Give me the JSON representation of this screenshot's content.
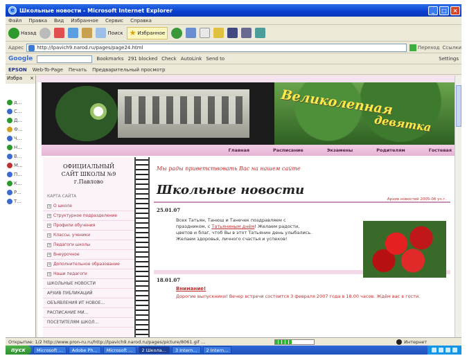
{
  "window": {
    "title": "Школьные новости - Microsoft Internet Explorer"
  },
  "menu": [
    "Файл",
    "Правка",
    "Вид",
    "Избранное",
    "Сервис",
    "Справка"
  ],
  "toolbar": {
    "back_label": "Назад",
    "search_label": "Поиск",
    "favorites_label": "Избранное"
  },
  "address": {
    "label": "Адрес",
    "url": "http://lpavich9.narod.ru/pages/page24.html",
    "go_label": "Переход",
    "links_label": "Ссылки"
  },
  "google": {
    "logo": "Google",
    "bookmarks_label": "Bookmarks",
    "blocked_label": "291 blocked",
    "check_label": "Check",
    "autolink_label": "AutoLink",
    "sendto_label": "Send to",
    "settings_label": "Settings"
  },
  "epson": {
    "logo": "EPSON",
    "web_to_page_label": "Web-To-Page",
    "print_label": "Печать",
    "preview_label": "Предварительный просмотр"
  },
  "leftpanel": {
    "label": "Избра"
  },
  "banner": {
    "title_line1": "Великолепная",
    "title_line2": "девятка"
  },
  "nav": [
    "Главная",
    "Расписание",
    "Экзамены",
    "Родителям",
    "Гостевая"
  ],
  "sidebar": {
    "caption": "ОФИЦИАЛЬНЫЙ\nСАЙТ ШКОЛЫ №9\nг.Павлово",
    "map_label": "КАРТА САЙТА",
    "items": [
      {
        "label": "О школе",
        "expandable": true
      },
      {
        "label": "Структурное подразделение",
        "expandable": true
      },
      {
        "label": "Профили обучения",
        "expandable": true
      },
      {
        "label": "Классы, ученики",
        "expandable": true
      },
      {
        "label": "Педагоги школы",
        "expandable": true
      },
      {
        "label": "Внеурочное",
        "expandable": true
      },
      {
        "label": "Дополнительное образование",
        "expandable": true
      },
      {
        "label": "Наши педагоги",
        "expandable": true
      },
      {
        "label": "ШКОЛЬНЫЕ НОВОСТИ",
        "expandable": false
      },
      {
        "label": "АРХИВ ПУБЛИКАЦИЙ",
        "expandable": false
      },
      {
        "label": "ОБЪЯВЛЕНИЯ ИТ НОВОЕ...",
        "expandable": false
      },
      {
        "label": "РАСПИСАНИЕ МИ...",
        "expandable": false
      },
      {
        "label": "ПОСЕТИТЕЛЯМ ШКОЛ...",
        "expandable": false
      }
    ]
  },
  "content": {
    "welcome": "Мы рады приветствовать Вас на нашем сайте",
    "page_title": "Школьные новости",
    "archive_link": "Архив новостей 2005-06 уч.г.",
    "news": [
      {
        "date": "25.01.07",
        "body_before": "Всех Татьян, Танюш и Танечек поздравляем с праздником, с ",
        "link": "Татьяниным днём",
        "body_after": "! Желаем радости, цветов и благ, чтоб Вы в этот Татьянин день улыбались. Желаем здоровья, личного счастья и успехов!"
      },
      {
        "date": "18.01.07",
        "headline": "Внимание!",
        "body": "Дорогие выпускники! Вечер встречи состоится 3 февраля 2007 года в 18.00 часов. Ждём вас в гости."
      }
    ]
  },
  "status": {
    "text": "Открытие: 1/2 http://www.pron-ru.ru/http://lpavich9.narod.ru/pages/picture/8061.gif ...",
    "progress": 0.45,
    "zone": "Интернет"
  },
  "taskbar": {
    "start": "пуск",
    "tasks": [
      "Microsoft ...",
      "Adobe Ph...",
      "Microsoft ...",
      "2 Школа...",
      "3 Intern...",
      "2 Intern..."
    ]
  }
}
